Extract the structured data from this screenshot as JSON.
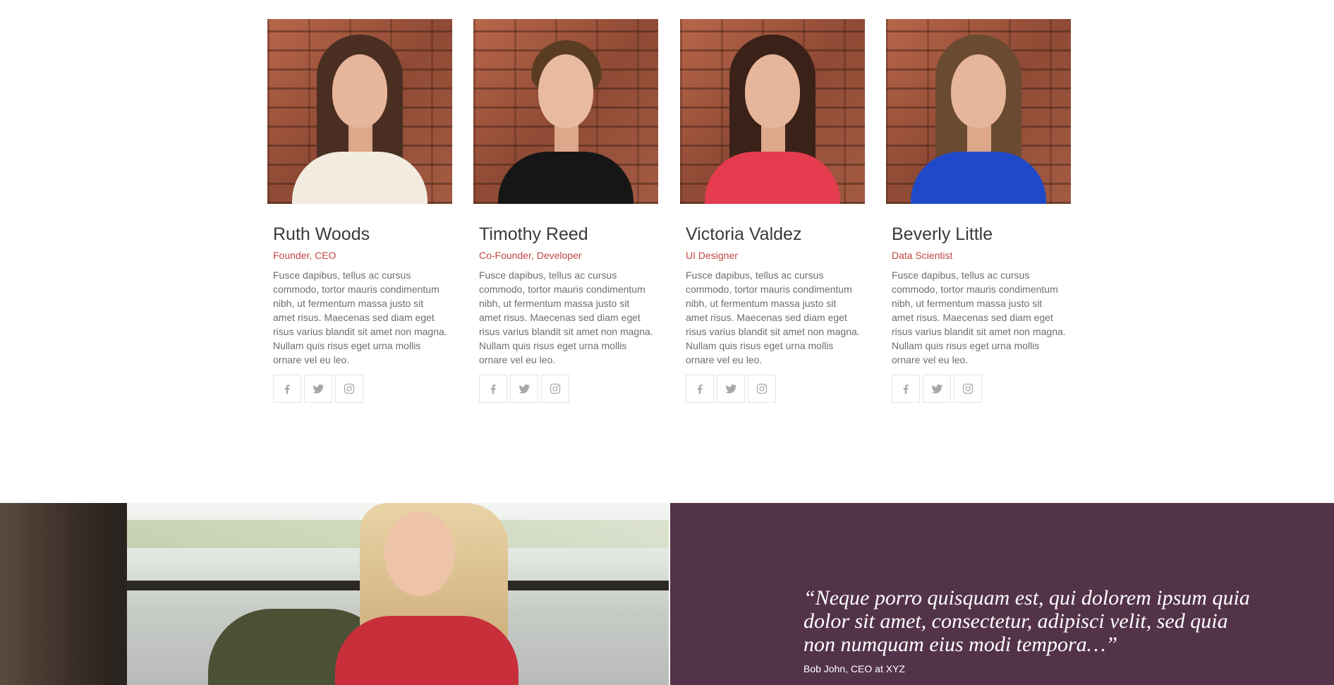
{
  "team": {
    "members": [
      {
        "name": "Ruth Woods",
        "role": "Founder, CEO",
        "bio": "Fusce dapibus, tellus ac cursus commodo, tortor mauris condimentum nibh, ut fermentum massa justo sit amet risus. Maecenas sed diam eget risus varius blandit sit amet non magna. Nullam quis risus eget urna mollis ornare vel eu leo."
      },
      {
        "name": "Timothy Reed",
        "role": "Co-Founder, Developer",
        "bio": "Fusce dapibus, tellus ac cursus commodo, tortor mauris condimentum nibh, ut fermentum massa justo sit amet risus. Maecenas sed diam eget risus varius blandit sit amet non magna. Nullam quis risus eget urna mollis ornare vel eu leo."
      },
      {
        "name": "Victoria Valdez",
        "role": "UI Designer",
        "bio": "Fusce dapibus, tellus ac cursus commodo, tortor mauris condimentum nibh, ut fermentum massa justo sit amet risus. Maecenas sed diam eget risus varius blandit sit amet non magna. Nullam quis risus eget urna mollis ornare vel eu leo."
      },
      {
        "name": "Beverly Little",
        "role": "Data Scientist",
        "bio": "Fusce dapibus, tellus ac cursus commodo, tortor mauris condimentum nibh, ut fermentum massa justo sit amet risus. Maecenas sed diam eget risus varius blandit sit amet non magna. Nullam quis risus eget urna mollis ornare vel eu leo."
      }
    ],
    "social_icons": [
      "facebook-icon",
      "twitter-icon",
      "instagram-icon"
    ]
  },
  "testimonial": {
    "quote": "“Neque porro quisquam est, qui dolorem ipsum quia dolor sit amet, consectetur, adipisci velit, sed quia non numquam eius modi tempora…”",
    "author": "Bob John, CEO at XYZ"
  },
  "colors": {
    "accent": "#c1463f",
    "panel": "#533349",
    "text": "#3a3a3a",
    "muted": "#6e6e6e"
  }
}
